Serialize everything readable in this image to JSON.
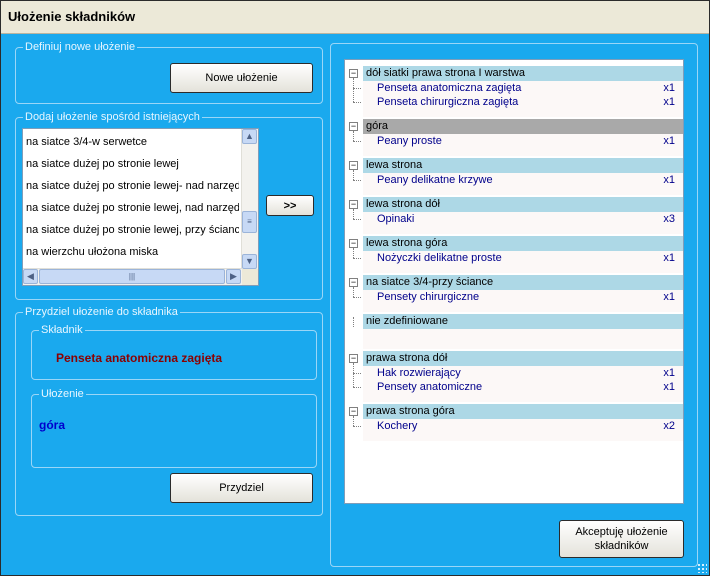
{
  "window": {
    "title": "Ułożenie składników"
  },
  "define_group": {
    "legend": "Definiuj nowe ułożenie",
    "new_button": "Nowe ułożenie"
  },
  "existing_group": {
    "legend": "Dodaj ułożenie spośród istniejących",
    "items": [
      "na siatce 3/4-w serwetce",
      "na siatce dużej po stronie lewej",
      "na siatce dużej po stronie lewej- nad narzędziami",
      "na siatce dużej po stronie lewej, nad narzędziami",
      "na siatce dużej po stronie lewej, przy ściance",
      "na wierzchu ułożona miska"
    ],
    "add_button": ">>"
  },
  "assign_group": {
    "legend": "Przydziel ułożenie do składnika",
    "component_legend": "Składnik",
    "component_value": "Penseta anatomiczna zagięta",
    "component_color": "#8b0000",
    "placement_legend": "Ułożenie",
    "placement_value": "góra",
    "placement_color": "#0000cd",
    "assign_button": "Przydziel"
  },
  "tree": {
    "expander_symbol": "⊟",
    "groups": [
      {
        "name": "dół siatki prawa strona  I warstwa",
        "selected": false,
        "items": [
          {
            "name": "Penseta anatomiczna zagięta",
            "qty": "x1"
          },
          {
            "name": "Penseta chirurgiczna zagięta",
            "qty": "x1"
          }
        ]
      },
      {
        "name": "góra",
        "selected": true,
        "items": [
          {
            "name": "Peany proste",
            "qty": "x1"
          }
        ]
      },
      {
        "name": "lewa strona",
        "selected": false,
        "items": [
          {
            "name": "Peany delikatne krzywe",
            "qty": "x1"
          }
        ]
      },
      {
        "name": "lewa strona dół",
        "selected": false,
        "items": [
          {
            "name": "Opinaki",
            "qty": "x3"
          }
        ]
      },
      {
        "name": "lewa strona góra",
        "selected": false,
        "items": [
          {
            "name": "Nożyczki delikatne proste",
            "qty": "x1"
          }
        ]
      },
      {
        "name": "na siatce 3/4-przy ściance",
        "selected": false,
        "items": [
          {
            "name": "Pensety chirurgiczne",
            "qty": "x1"
          }
        ]
      },
      {
        "name": "nie zdefiniowane",
        "selected": false,
        "items": []
      },
      {
        "name": "prawa strona dół",
        "selected": false,
        "items": [
          {
            "name": "Hak rozwierający",
            "qty": "x1"
          },
          {
            "name": "Pensety anatomiczne",
            "qty": "x1"
          }
        ]
      },
      {
        "name": "prawa strona góra",
        "selected": false,
        "items": [
          {
            "name": "Kochery",
            "qty": "x2"
          }
        ]
      }
    ]
  },
  "accept_button": "Akceptuję ułożenie składników"
}
